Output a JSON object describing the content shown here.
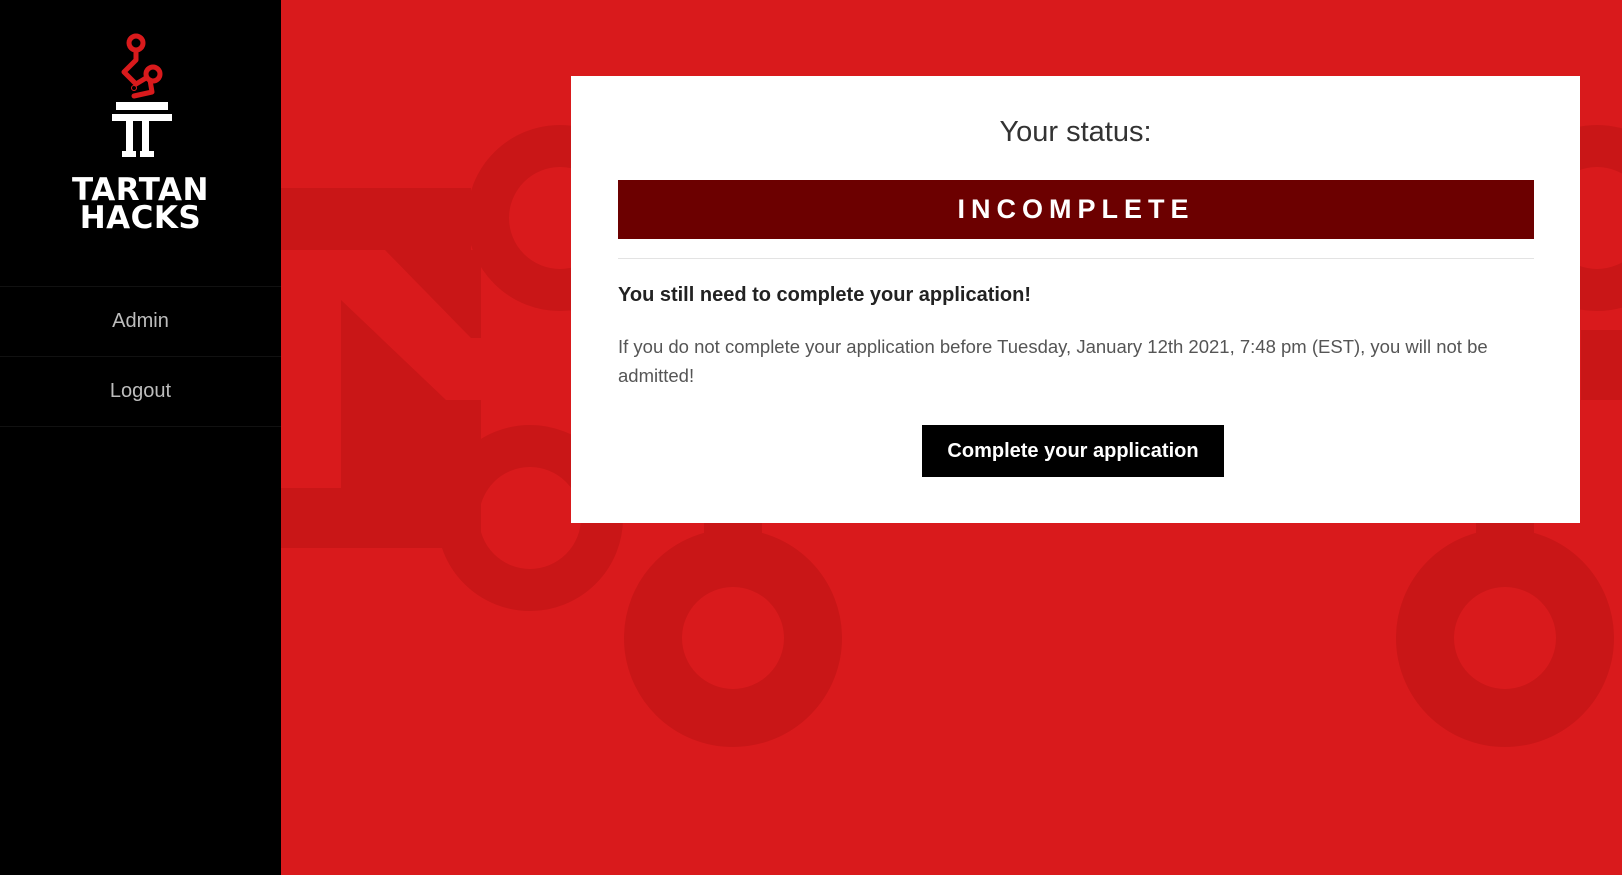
{
  "brand": {
    "name_line1": "TARTAN",
    "name_line2": "HACKS",
    "accent_color": "#d91a1c",
    "dark_red": "#6c0000"
  },
  "sidebar": {
    "items": [
      {
        "label": "Admin"
      },
      {
        "label": "Logout"
      }
    ]
  },
  "status_card": {
    "title": "Your status:",
    "status": "INCOMPLETE",
    "headline": "You still need to complete your application!",
    "deadline_message": "If you do not complete your application before Tuesday, January 12th 2021, 7:48 pm (EST), you will not be admitted!",
    "cta_label": "Complete your application"
  }
}
